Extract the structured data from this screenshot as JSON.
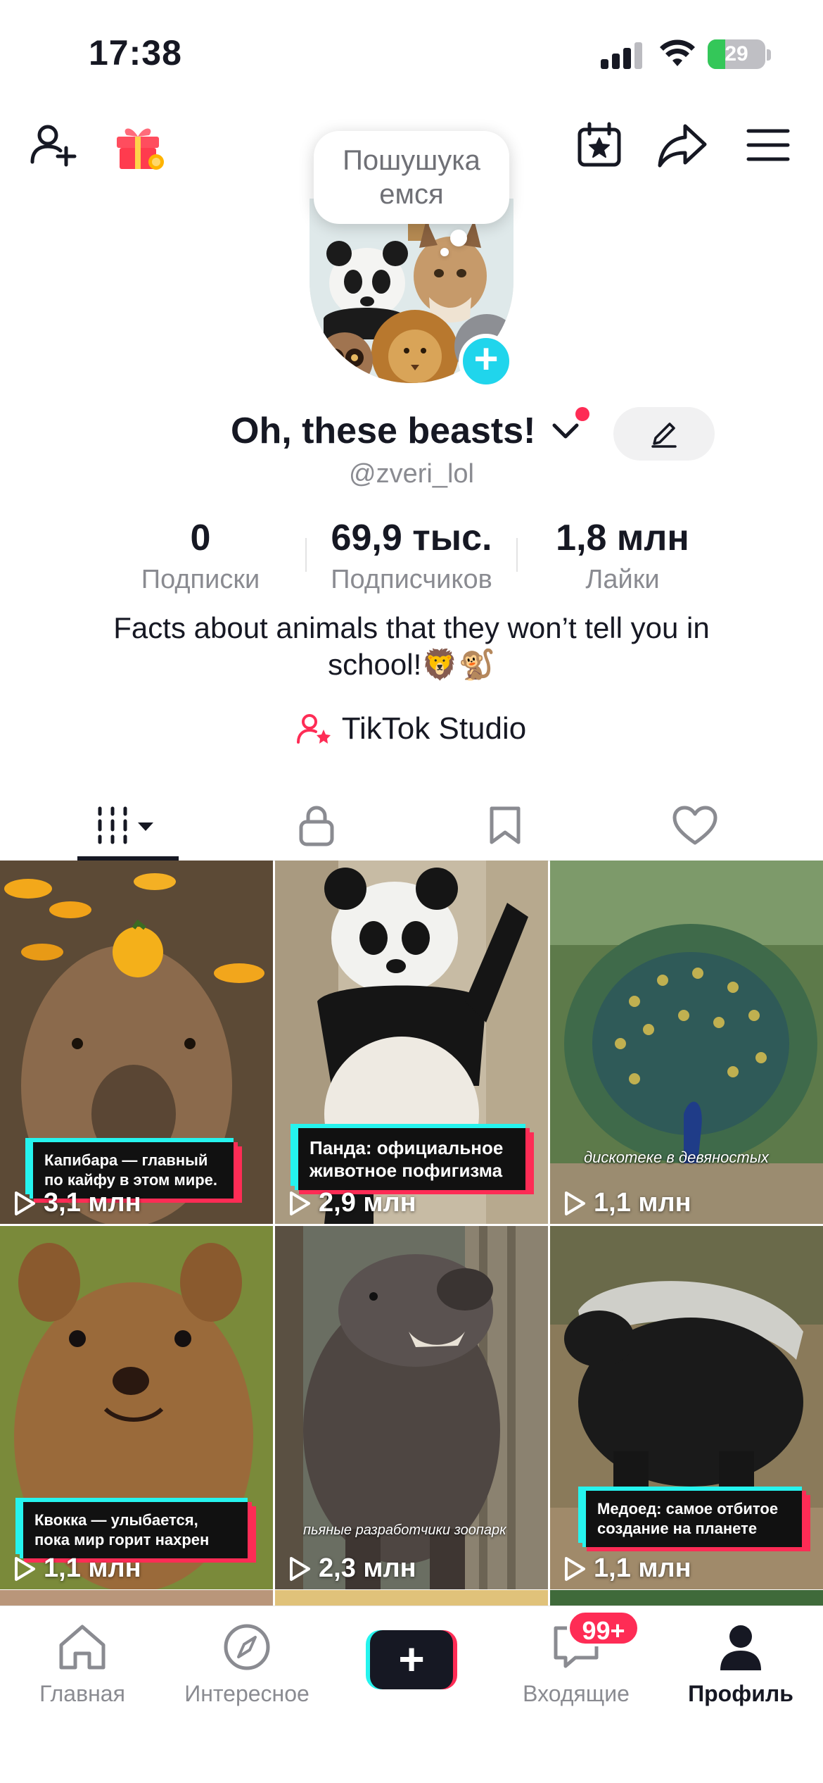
{
  "status_bar": {
    "time": "17:38",
    "battery": "29"
  },
  "profile": {
    "tooltip_line1": "Пошушука",
    "tooltip_line2": "емся",
    "display_name": "Oh, these beasts!",
    "handle": "@zveri_lol",
    "stats": [
      {
        "value": "0",
        "label": "Подписки"
      },
      {
        "value": "69,9 тыс.",
        "label": "Подписчиков"
      },
      {
        "value": "1,8 млн",
        "label": "Лайки"
      }
    ],
    "bio_line1": "Facts about animals that they won’t tell you in",
    "bio_line2": "school!🦁🐒",
    "studio_label": "TikTok Studio"
  },
  "videos": [
    {
      "caption": "Капибара — главный по кайфу в этом мире.",
      "views": "3,1 млн"
    },
    {
      "caption": "Панда: официальное животное пофигизма",
      "views": "2,9 млн"
    },
    {
      "caption": "дискотеке  в  девяностых",
      "views": "1,1 млн"
    },
    {
      "caption": "Квокка — улыбается, пока мир горит нахрен",
      "views": "1,1 млн"
    },
    {
      "caption": "пьяные  разработчики  зоопарк",
      "views": "2,3 млн"
    },
    {
      "caption": "Медоед: самое отбитое создание на планете",
      "views": "1,1 млн"
    }
  ],
  "bottom_nav": {
    "home": "Главная",
    "discover": "Интересное",
    "inbox": "Входящие",
    "inbox_badge": "99+",
    "profile": "Профиль"
  },
  "colors": {
    "accent_red": "#fe2c55",
    "accent_cyan": "#25f4ee",
    "text": "#161823",
    "muted": "#8a8b91"
  },
  "icons": [
    "add-friend-icon",
    "gift-icon",
    "calendar-star-icon",
    "share-icon",
    "menu-icon",
    "edit-icon",
    "grid-icon",
    "lock-icon",
    "bookmark-icon",
    "heart-icon",
    "home-icon",
    "compass-icon",
    "inbox-icon",
    "profile-icon"
  ]
}
